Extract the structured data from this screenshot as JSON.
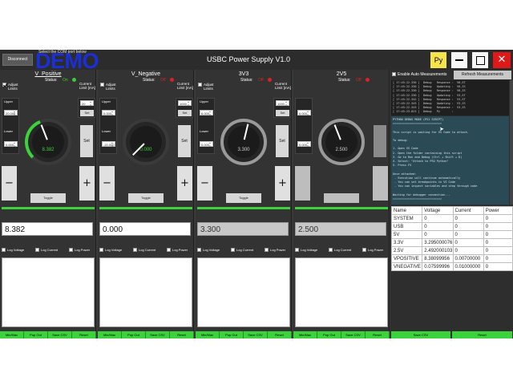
{
  "titlebar": {
    "disconnect_label": "Disconnect",
    "com_label": "Select the COM port below",
    "demo_text": "DEMO",
    "title": "USBC Power Supply V1.0",
    "py_label": "Py",
    "close_glyph": "✕"
  },
  "panels": [
    {
      "title": "V_Positive",
      "status_label": "Status:",
      "status": "On",
      "adjust_label": "Adjust Limits",
      "adjust_checked": true,
      "current_label": "Current Limit [mA]",
      "upper_label": "Upper",
      "upper_value": "20.000",
      "lower_label": "Lower",
      "lower_value": "0.000",
      "current_value": "20",
      "set_label": "Set",
      "big_set_label": "Set",
      "knob_value": "8.382",
      "knob_fraction": 0.42,
      "arc_fraction": 0.42,
      "minus_label": "−",
      "plus_label": "+",
      "toggle_label": "Toggle",
      "reading": "8.382",
      "log_voltage": "Log Voltage",
      "log_current": "Log Current",
      "log_power": "Log Power",
      "btn_minmax": "Min/Max",
      "btn_popout": "Pop Out",
      "btn_savecsv": "Save CSV",
      "btn_reset": "Reset"
    },
    {
      "title": "V_Negative",
      "status_label": "Status:",
      "status": "Off",
      "adjust_label": "Adjust Limits",
      "adjust_checked": false,
      "current_label": "Current Limit [mA]",
      "upper_label": "Upper",
      "upper_value": "0.000",
      "lower_label": "Lower",
      "lower_value": "-20.000",
      "current_value": "1000",
      "set_label": "Set",
      "big_set_label": "Set",
      "knob_value": "0.000",
      "knob_fraction": 0.0,
      "arc_fraction": 0.0,
      "minus_label": "−",
      "plus_label": "+",
      "toggle_label": "Toggle",
      "reading": "0.000",
      "log_voltage": "Log Voltage",
      "log_current": "Log Current",
      "log_power": "Log Power",
      "btn_minmax": "Min/Max",
      "btn_popout": "Pop Out",
      "btn_savecsv": "Save CSV",
      "btn_reset": "Reset"
    },
    {
      "title": "3V3",
      "status_label": "Status:",
      "status": "Off",
      "adjust_label": "Adjust Limits",
      "adjust_checked": false,
      "current_label": "Current Limit [mA]",
      "upper_label": "Upper",
      "upper_value": "6.000",
      "lower_label": "Lower",
      "lower_value": "0.000",
      "current_value": "1000",
      "set_label": "Set",
      "big_set_label": "Set",
      "knob_value": "3.300",
      "knob_fraction": 0.55,
      "arc_fraction": 0.0,
      "minus_label": "−",
      "plus_label": "+",
      "toggle_label": "Toggle",
      "reading": "3.300",
      "log_voltage": "Log Voltage",
      "log_current": "Log Current",
      "log_power": "Log Power",
      "btn_minmax": "Min/Max",
      "btn_popout": "Pop Out",
      "btn_savecsv": "Save CSV",
      "btn_reset": "Reset"
    },
    {
      "title": "2V5",
      "status_label": "Status:",
      "status": "Off",
      "adjust_label": "",
      "adjust_checked": false,
      "current_label": "",
      "upper_label": "",
      "upper_value": "6.000",
      "lower_label": "",
      "lower_value": "0.000",
      "current_value": "",
      "set_label": "",
      "big_set_label": "",
      "knob_value": "2.500",
      "knob_fraction": 0.42,
      "arc_fraction": 0.0,
      "minus_label": "",
      "plus_label": "",
      "toggle_label": "",
      "reading": "2.500",
      "log_voltage": "Log Voltage",
      "log_current": "Log Current",
      "log_power": "Log Power",
      "btn_minmax": "Min/Max",
      "btn_popout": "Pop Out",
      "btn_savecsv": "Save CSV",
      "btn_reset": "Reset"
    }
  ],
  "right_panel": {
    "auto_label": "Enable Auto Measurements",
    "refresh_label": "Refresh Measurements",
    "console_log": "[ 17:45:22.330 ]  Debug   Response :  V0,ST\n[ 17:45:22.330 ]  Debug   Updating :  V0,IS\n[ 17:45:22.330 ]  Debug   Response :  V0,IS\n[ 17:45:22.330 ]  Debug   Updating :  V3,ST\n[ 17:45:22.342 ]  Debug   Response :  V3,ST\n[ 17:45:22.343 ]  Debug   Updating :  V3,IS\n[ 17:45:22.343 ]  Debug   Response :  V3,IS\n[ 17:45:23.023 ]  Debug   Py       :",
    "console_main": "PYTHON DEBUG MODE (PS1 SCRIPT)\n=============================\n\nThis script is waiting for VS Code to attach.\n\nTo debug:\n\n1. Open VS Code\n2. Open the folder containing this script\n3. Go to Run and Debug (Ctrl + Shift + D)\n4. Select: \"Attach to PSU Python\"\n5. Press F5\n\nOnce attached:\n - Execution will continue automatically\n - You can set breakpoints in VS Code\n - You can inspect variables and step through code\n\nWaiting for debugger connection...\n=============================",
    "table_headers": [
      "Name",
      "Voltage",
      "Current",
      "Power"
    ],
    "table_rows": [
      [
        "SYSTEM",
        "0",
        "0",
        "0"
      ],
      [
        "USB",
        "0",
        "0",
        "0"
      ],
      [
        "5V",
        "0",
        "0",
        "0"
      ],
      [
        "3.3V",
        "3.295000076",
        "0",
        "0"
      ],
      [
        "2.5V",
        "2.492000103",
        "0",
        "0"
      ],
      [
        "VPOSITIVE",
        "8.38099956",
        "0.00700000",
        "0"
      ],
      [
        "VNEGATIVE",
        "0.07599996",
        "0.01000000",
        "0"
      ]
    ],
    "btn_savecsv": "Save CSV",
    "btn_reset": "Reset"
  },
  "colors": {
    "accent_green": "#3cd23c",
    "status_on": "#3ccb3c",
    "status_off": "#e02020",
    "demo_blue": "#1a2fd6",
    "py_yellow": "#f5e44a",
    "close_red": "#e01818"
  }
}
